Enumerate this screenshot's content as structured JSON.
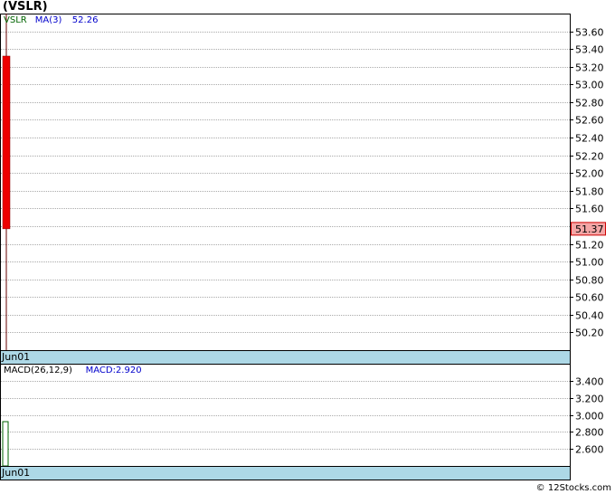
{
  "title": "(VSLR)",
  "footer": "© 12Stocks.com",
  "chart_data": [
    {
      "type": "candlestick",
      "legend": [
        {
          "label": "VSLR",
          "color": "#006400"
        },
        {
          "label": "MA(3)",
          "color": "#0000cc"
        },
        {
          "label": "52.26",
          "color": "#0000cc"
        }
      ],
      "x_label": "Jun01",
      "ylim": [
        50.0,
        53.8
      ],
      "y_ticks": [
        "53.60",
        "53.40",
        "53.20",
        "53.00",
        "52.80",
        "52.60",
        "52.40",
        "52.20",
        "52.00",
        "51.80",
        "51.60",
        "51.40",
        "51.20",
        "51.00",
        "50.80",
        "50.60",
        "50.40",
        "50.20"
      ],
      "last_price_label": "51.37",
      "candles": [
        {
          "date": "Jun01",
          "open": 53.32,
          "close": 51.37,
          "high": 53.95,
          "low": 50.0,
          "color": "#ee0000"
        }
      ]
    },
    {
      "type": "bar",
      "legend": [
        {
          "label": "MACD(26,12,9)",
          "color": "#000000"
        },
        {
          "label": "MACD:2.920",
          "color": "#0000cc"
        }
      ],
      "x_label": "Jun01",
      "ylim": [
        2.4,
        3.6
      ],
      "y_ticks": [
        "3.400",
        "3.200",
        "3.000",
        "2.800",
        "2.600"
      ],
      "bars": [
        {
          "date": "Jun01",
          "value": 2.92,
          "color": "#006400"
        }
      ]
    }
  ],
  "colors": {
    "grid": "#aaaaaa",
    "axis_band": "#add8e6",
    "price_tag_fill": "#f4a6a6"
  }
}
